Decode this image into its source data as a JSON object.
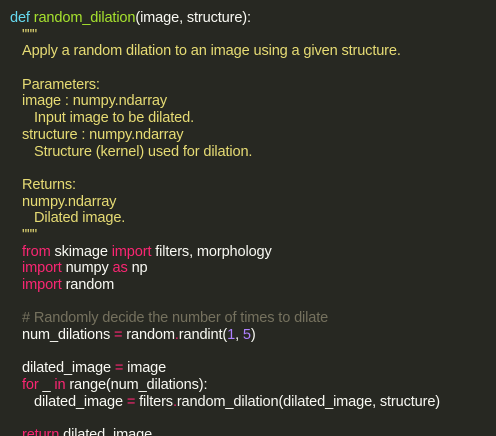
{
  "code": {
    "def_kw": "def",
    "func_name": "random_dilation",
    "func_params": "(image, structure):",
    "doc_open": "\"\"\"",
    "doc_summary": "Apply a random dilation to an image using a given structure.",
    "doc_params_header": "Parameters:",
    "doc_param1": "image : numpy.ndarray",
    "doc_param1_desc": "Input image to be dilated.",
    "doc_param2": "structure : numpy.ndarray",
    "doc_param2_desc": "Structure (kernel) used for dilation.",
    "doc_returns_header": "Returns:",
    "doc_return_type": "numpy.ndarray",
    "doc_return_desc": "Dilated image.",
    "doc_close": "\"\"\"",
    "from_kw": "from",
    "skimage_mod": "skimage",
    "import_kw": "import",
    "skimage_names": "filters, morphology",
    "numpy_mod": "numpy",
    "as_kw": "as",
    "np_alias": "np",
    "random_mod": "random",
    "comment": "# Randomly decide the number of times to dilate",
    "num_dil_var": "num_dilations",
    "eq": "=",
    "randint_call_a": "random",
    "dot": ".",
    "randint_call_b": "randint(",
    "num1": "1",
    "comma": ", ",
    "num5": "5",
    "close_paren": ")",
    "dilated_var": "dilated_image",
    "image_name": "image",
    "for_kw": "for",
    "underscore": "_",
    "in_kw": "in",
    "range_call": "range(num_dilations):",
    "filters_name": "filters",
    "dilation_call": "random_dilation(dilated_image, structure)",
    "return_kw": "return",
    "return_value": "dilated_image"
  }
}
